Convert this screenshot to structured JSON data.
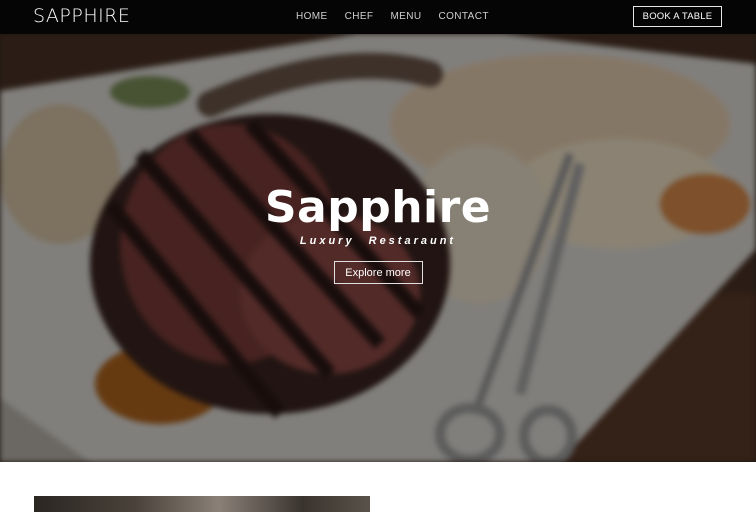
{
  "nav": {
    "brand": "SAPPHIRE",
    "links": [
      {
        "label": "HOME"
      },
      {
        "label": "CHEF"
      },
      {
        "label": "MENU"
      },
      {
        "label": "CONTACT"
      }
    ],
    "cta_label": "BOOK A TABLE"
  },
  "hero": {
    "title": "Sapphire",
    "subtitle": "Luxury Restaraunt",
    "button_label": "Explore more",
    "image_subject": "grilled steak on a white plate with tongs"
  },
  "colors": {
    "nav_bg": "#050505",
    "text_light": "#ffffff",
    "nav_link": "#cfcfcf",
    "overlay": "rgba(0,0,0,0.42)"
  }
}
